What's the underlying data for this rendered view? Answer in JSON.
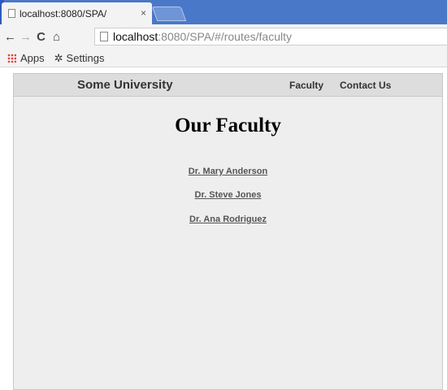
{
  "browser": {
    "tab": {
      "title": "localhost:8080/SPA/",
      "close_label": "×"
    },
    "toolbar": {
      "back": "←",
      "forward": "→",
      "reload": "C",
      "home": "⌂"
    },
    "address": {
      "host": "localhost",
      "rest": ":8080/SPA/#/routes/faculty"
    },
    "bookmarks": [
      {
        "label": "Apps",
        "icon": "apps-grid-icon"
      },
      {
        "label": "Settings",
        "icon": "gear-icon"
      }
    ],
    "colors": {
      "tabstrip": "#4a78c8",
      "toolbar": "#f3f3f3"
    }
  },
  "site": {
    "brand": "Some University",
    "nav": [
      "Faculty",
      "Contact Us"
    ],
    "heading": "Our Faculty",
    "faculty": [
      "Dr. Mary Anderson",
      "Dr. Steve Jones",
      "Dr. Ana Rodriguez"
    ],
    "colors": {
      "page_bg": "#eeeeee",
      "nav_bg": "#dddddd",
      "link": "#555555"
    }
  }
}
